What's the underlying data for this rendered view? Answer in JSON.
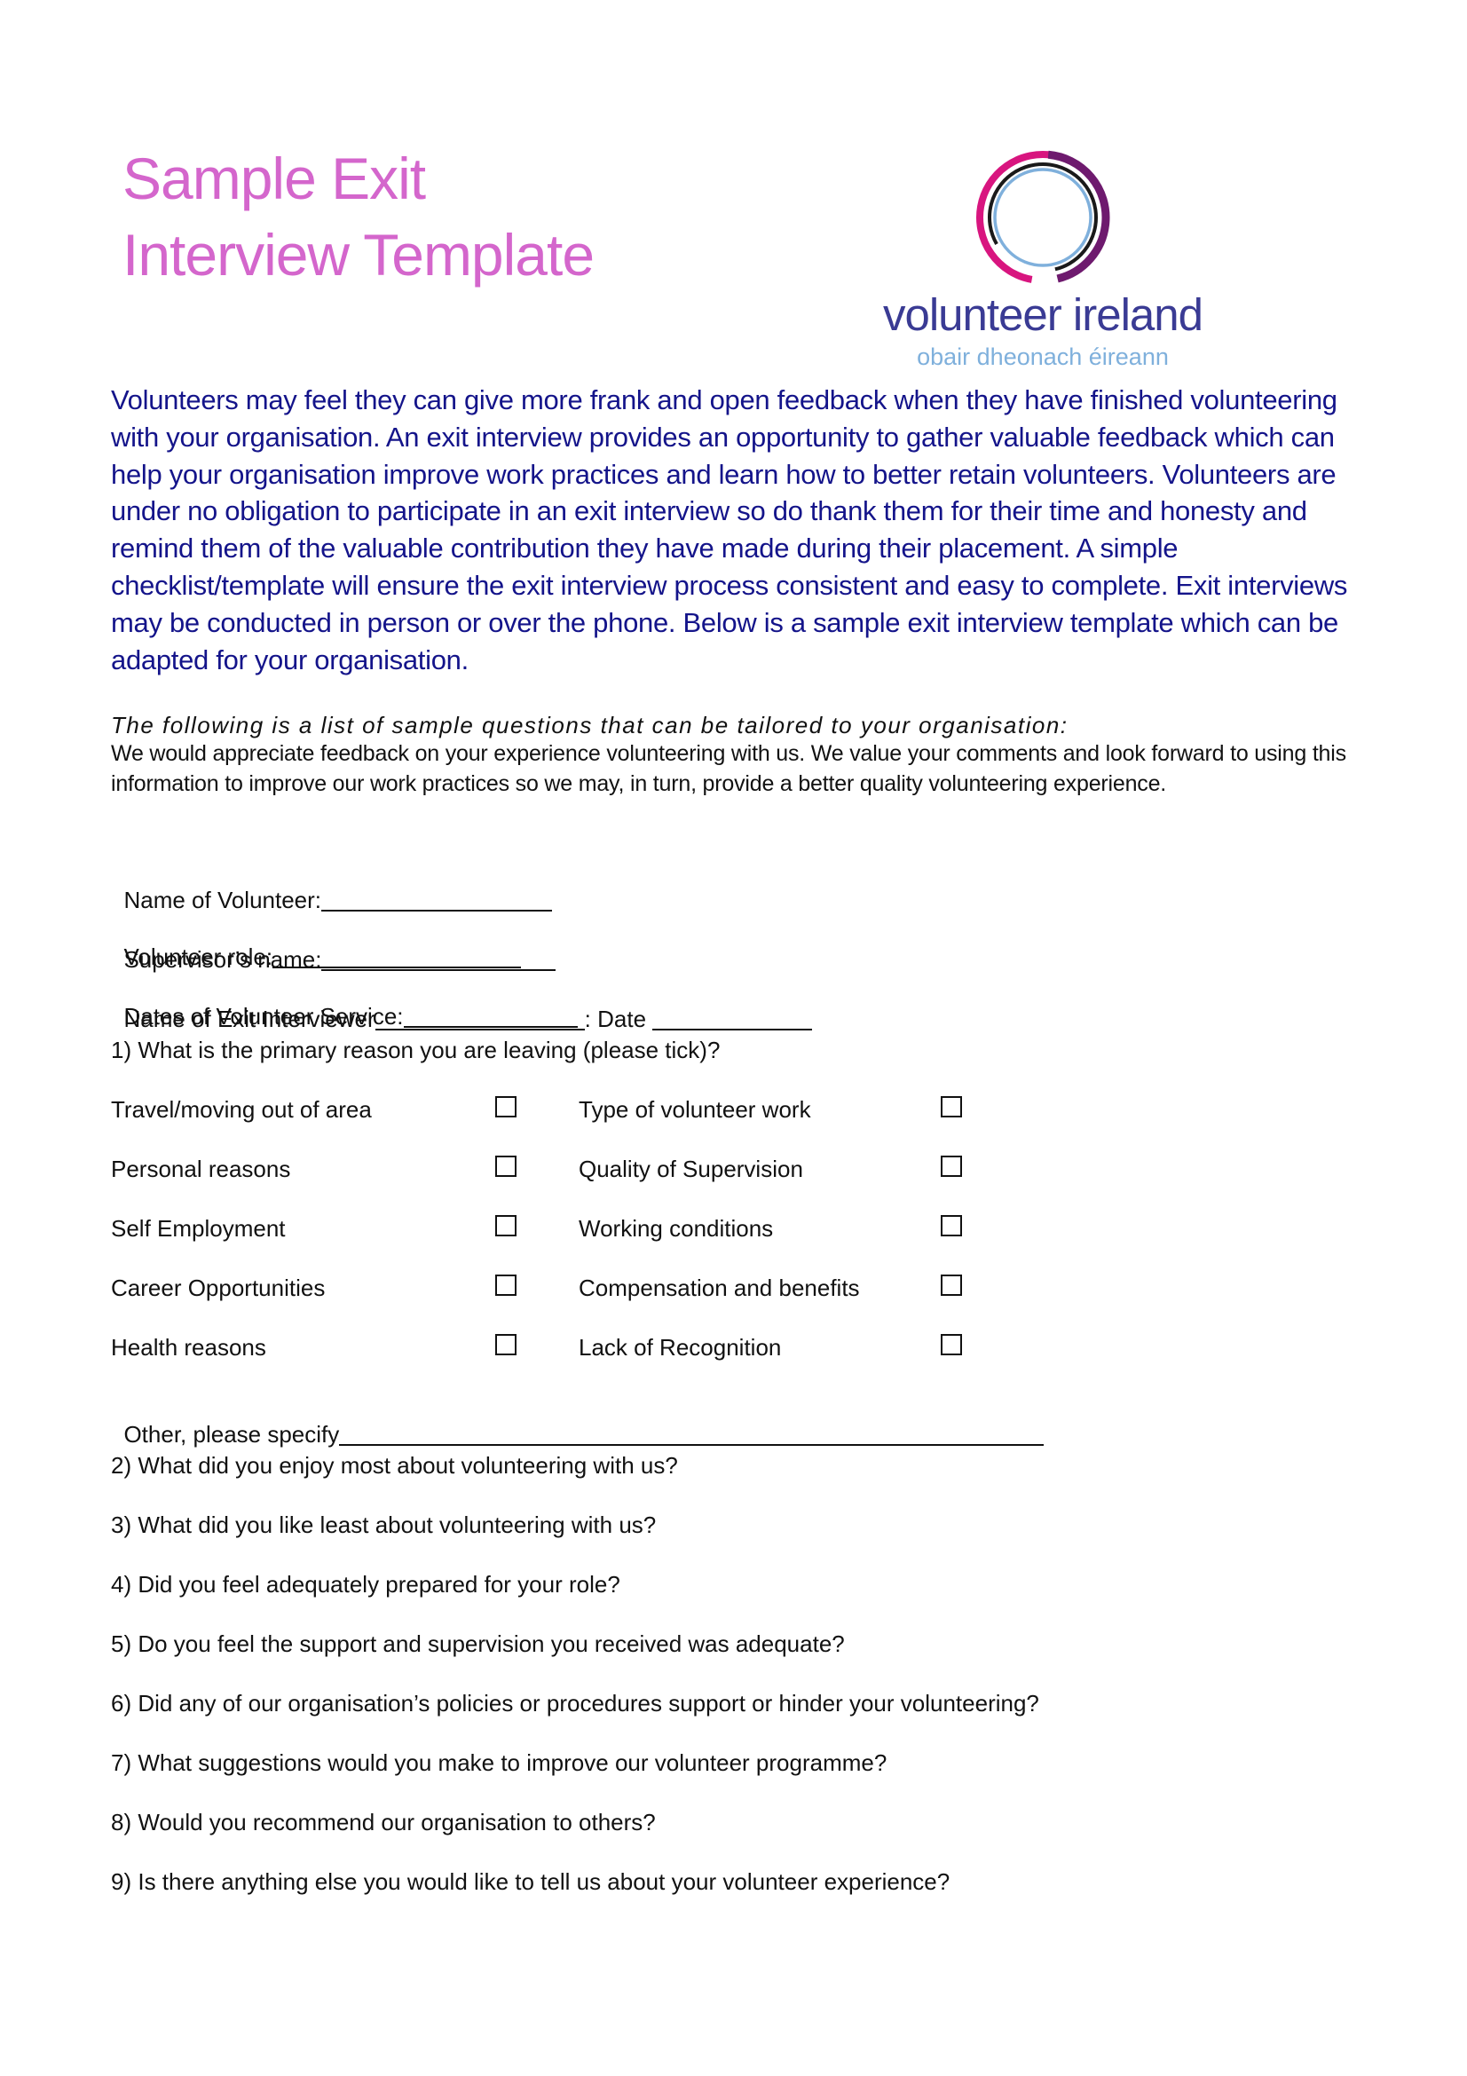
{
  "document": {
    "title_line1": "Sample Exit",
    "title_line2": "Interview Template",
    "colors": {
      "title": "#d466cc",
      "intro_text": "#14148a",
      "logo_brand": "#3a3b94",
      "logo_tagline": "#7fb0dc",
      "logo_ring_pink": "#d8157f",
      "logo_ring_purple": "#6e1a6e",
      "logo_ring_black": "#1a1a1a",
      "logo_ring_blue": "#7fb0dc"
    }
  },
  "logo": {
    "brand": "volunteer ireland",
    "tagline": "obair dheonach éireann"
  },
  "intro": "Volunteers may feel they can give more frank and open feedback when they have finished volunteering with your organisation. An exit interview provides an opportunity to gather valuable feedback which can help your organisation improve work practices and learn how to better retain volunteers. Volunteers are under no obligation to participate in an exit interview so do thank them for their time and honesty and remind them of the valuable contribution they have made during their placement. A simple checklist/template will ensure the exit interview process consistent and easy to complete. Exit interviews may be conducted in person or over the phone. Below is a sample exit interview template which can be adapted for your organisation.",
  "list_heading": "The following is a list of sample questions that can be tailored to your organisation:",
  "list_intro": "We would appreciate feedback on your experience volunteering with us. We value your comments and look forward to using this information to improve our work practices so we may, in turn, provide a better quality volunteering experience.",
  "fields": {
    "volunteer_name": "Name of Volunteer:",
    "volunteer_role": "Volunteer role:",
    "supervisor_name": "Supervisor’s name:",
    "service_dates": "Dates of Volunteer Service:",
    "exit_interviewer": "Name of Exit Interviewer",
    "date": ": Date ",
    "other_specify": "Other, please specify"
  },
  "question1": "1) What is the primary reason you are leaving (please tick)?",
  "reasons_left": [
    {
      "label": "Travel/moving out of area",
      "checked": false
    },
    {
      "label": "Personal reasons",
      "checked": false
    },
    {
      "label": "Self Employment",
      "checked": false
    },
    {
      "label": "Career Opportunities",
      "checked": false
    },
    {
      "label": "Health reasons",
      "checked": false
    }
  ],
  "reasons_right": [
    {
      "label": "Type of volunteer work",
      "checked": false
    },
    {
      "label": "Quality of Supervision",
      "checked": false
    },
    {
      "label": "Working conditions",
      "checked": false
    },
    {
      "label": "Compensation and benefits",
      "checked": false
    },
    {
      "label": "Lack of Recognition",
      "checked": false
    }
  ],
  "questions": [
    "2) What did you enjoy most about volunteering with us?",
    "3) What did you like least about volunteering with us?",
    "4) Did you feel adequately prepared for your role?",
    "5) Do you feel the support and supervision you received was adequate?",
    "6) Did any of our organisation’s policies or procedures support or hinder your volunteering?",
    "7) What suggestions would you make to improve our volunteer programme?",
    "8) Would you recommend our organisation to others?",
    "9) Is there anything else you would like to tell us about your volunteer experience?"
  ]
}
